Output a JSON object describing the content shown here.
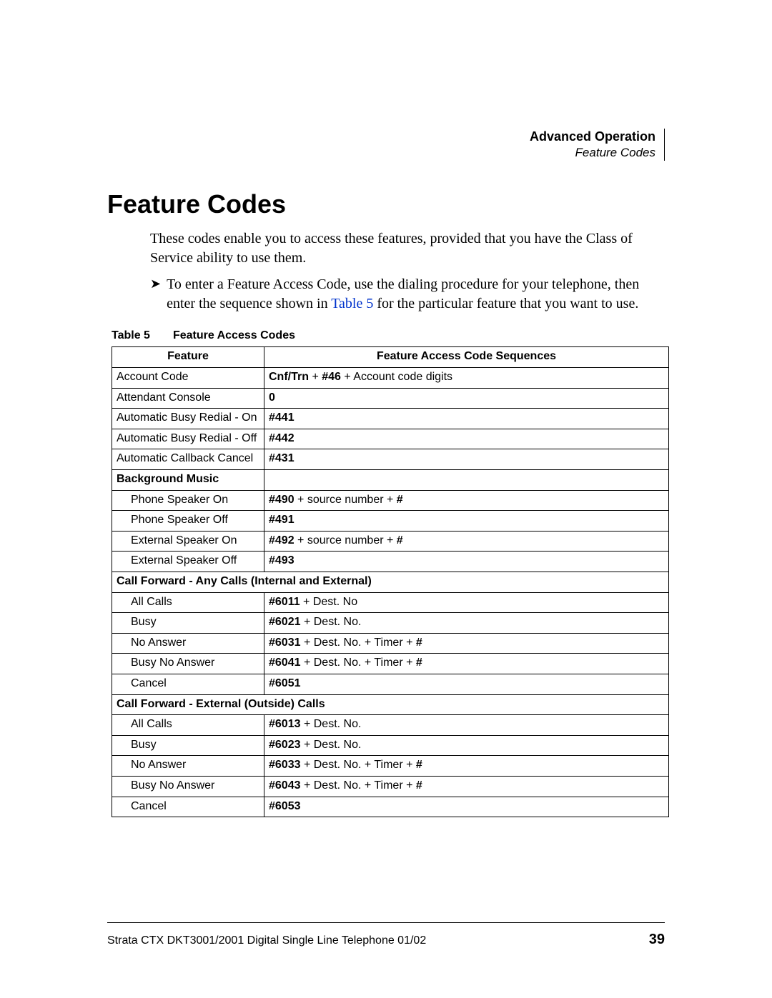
{
  "header": {
    "section": "Advanced Operation",
    "subsection": "Feature Codes"
  },
  "title": "Feature Codes",
  "intro": "These codes enable you to access these features, provided that you have the Class of Service ability to use them.",
  "bullet_prefix": "To enter a Feature Access Code, use the dialing procedure for your telephone, then enter the sequence shown in ",
  "bullet_link": "Table 5",
  "bullet_suffix": " for the particular feature that you want to use.",
  "caption_label": "Table 5",
  "caption_title": "Feature Access Codes",
  "th1": "Feature",
  "th2": "Feature Access Code Sequences",
  "rows": {
    "r0f": "Account Code",
    "r0a": "Cnf/Trn",
    "r0b": " + ",
    "r0c": "#46",
    "r0d": " + Account code digits",
    "r1f": "Attendant Console",
    "r1c": "0",
    "r2f": "Automatic Busy Redial - On",
    "r2c": "#441",
    "r3f": "Automatic Busy Redial - Off",
    "r3c": "#442",
    "r4f": "Automatic Callback Cancel",
    "r4c": "#431",
    "r5f": "Background Music",
    "r6f": "Phone Speaker On",
    "r6c": "#490",
    "r6d": " + source number + ",
    "r6e": "#",
    "r7f": "Phone Speaker Off",
    "r7c": "#491",
    "r8f": "External Speaker On",
    "r8c": "#492",
    "r8d": " + source number + ",
    "r8e": "#",
    "r9f": "External Speaker Off",
    "r9c": "#493",
    "r10f": "Call Forward - Any Calls (Internal and External)",
    "r11f": "All Calls",
    "r11c": "#6011",
    "r11d": " + Dest. No",
    "r12f": "Busy",
    "r12c": "#6021",
    "r12d": " + Dest. No.",
    "r13f": "No Answer",
    "r13c": "#6031",
    "r13d": " + Dest. No. + Timer + ",
    "r13e": "#",
    "r14f": "Busy No Answer",
    "r14c": "#6041",
    "r14d": " + Dest. No. + Timer + ",
    "r14e": "#",
    "r15f": "Cancel",
    "r15c": "#6051",
    "r16f": "Call Forward - External (Outside) Calls",
    "r17f": "All Calls",
    "r17c": "#6013",
    "r17d": " + Dest. No.",
    "r18f": "Busy",
    "r18c": "#6023",
    "r18d": " + Dest. No.",
    "r19f": "No Answer",
    "r19c": "#6033",
    "r19d": " + Dest. No. + Timer + ",
    "r19e": "#",
    "r20f": "Busy No Answer",
    "r20c": "#6043",
    "r20d": " + Dest. No. + Timer + ",
    "r20e": "#",
    "r21f": "Cancel",
    "r21c": "#6053"
  },
  "footer": {
    "doc": "Strata CTX DKT3001/2001 Digital Single Line Telephone   01/02",
    "page": "39"
  }
}
